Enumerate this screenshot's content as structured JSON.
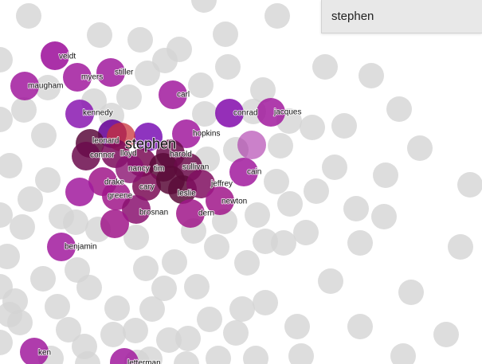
{
  "search": {
    "value": "stephen",
    "placeholder": ""
  },
  "colors": {
    "background_dot": "#d4d4d4",
    "highlight_dot": "#a11a9e",
    "dark_dot": "#5a0a3c",
    "accent_dot": "#c8313a"
  },
  "labels": {
    "stephen": "stephen",
    "veidt": "veidt",
    "myers": "myers",
    "stiller": "stiller",
    "maugham": "maugham",
    "carl": "carl",
    "kennedy": "kennedy",
    "conrad": "conrad",
    "jacques": "jacques",
    "hopkins": "hopkins",
    "leonard": "leonard",
    "connor": "connor",
    "lloyd": "lloyd",
    "harold": "harold",
    "nancy": "nancy",
    "tim": "tim",
    "sullivan": "sullivan",
    "cain": "cain",
    "drake": "drake",
    "cary": "cary",
    "jeffrey": "jeffrey",
    "greene": "greene",
    "leslie": "leslie",
    "newton": "newton",
    "brosnan": "brosnan",
    "dern": "dern",
    "benjamin": "benjamin",
    "ken": "ken",
    "letterman": "letterman"
  }
}
